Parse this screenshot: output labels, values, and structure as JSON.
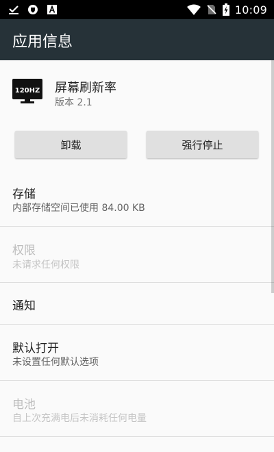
{
  "status_bar": {
    "time": "10:09",
    "left_icons": [
      "download-done-icon",
      "shield-icon",
      "font-a-icon"
    ],
    "right_icons": [
      "wifi-icon",
      "no-sim-icon",
      "battery-charging-icon"
    ]
  },
  "app_bar": {
    "title": "应用信息",
    "background": "#263238"
  },
  "app": {
    "name": "屏幕刷新率",
    "version": "版本 2.1",
    "icon_text": "120HZ"
  },
  "buttons": {
    "uninstall": "卸载",
    "force_stop": "强行停止"
  },
  "prefs": [
    {
      "title": "存储",
      "summary": "内部存储空间已使用 84.00 KB",
      "enabled": true
    },
    {
      "title": "权限",
      "summary": "未请求任何权限",
      "enabled": false
    },
    {
      "title": "通知",
      "summary": "",
      "enabled": true
    },
    {
      "title": "默认打开",
      "summary": "未设置任何默认选项",
      "enabled": true
    },
    {
      "title": "电池",
      "summary": "自上次充满电后未消耗任何电量",
      "enabled": false
    }
  ]
}
